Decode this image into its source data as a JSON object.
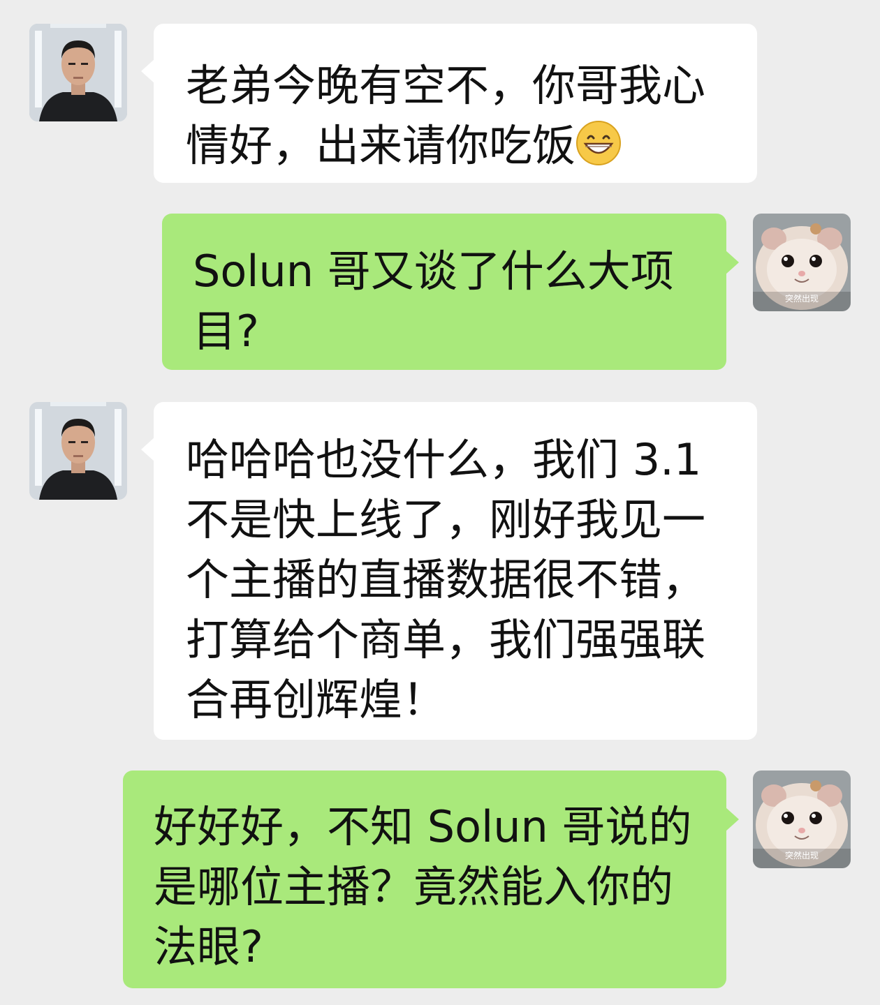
{
  "messages": [
    {
      "side": "in",
      "lines": [
        "老弟今晚有空不，你哥我心",
        "情好，出来请你吃饭"
      ],
      "emoji": "grinning-face-emoji"
    },
    {
      "side": "out",
      "lines": [
        "Solun 哥又谈了什么大项",
        "目?"
      ]
    },
    {
      "side": "in",
      "lines": [
        "哈哈哈也没什么，我们 3.1",
        "不是快上线了，刚好我见一",
        "个主播的直播数据很不错，",
        "打算给个商单，我们强强联",
        "合再创辉煌！"
      ]
    },
    {
      "side": "out",
      "lines": [
        "好好好，不知 Solun 哥说的",
        "是哪位主播？竟然能入你的",
        "法眼?"
      ]
    }
  ],
  "sticker_caption": "突然出现",
  "colors": {
    "background": "#ededed",
    "incoming_bubble": "#ffffff",
    "outgoing_bubble": "#a9e97b"
  }
}
